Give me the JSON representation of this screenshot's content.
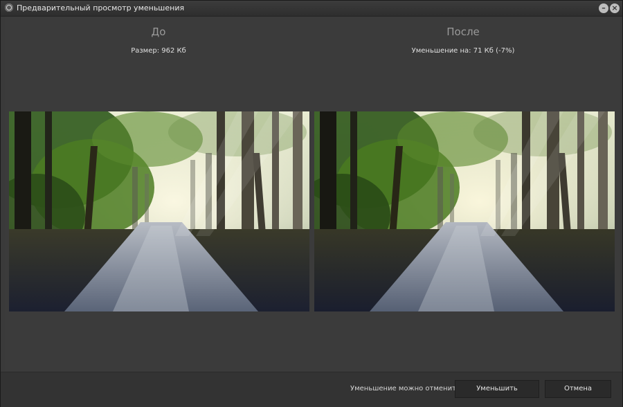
{
  "window": {
    "title": "Предварительный просмотр уменьшения",
    "icons": {
      "app": "app-icon",
      "minimize": "minimize-icon",
      "close": "close-icon"
    }
  },
  "before": {
    "heading": "До",
    "size_text": "Размер: 962 Кб"
  },
  "after": {
    "heading": "После",
    "reduction_text": "Уменьшение на: 71 Кб (-7%)"
  },
  "footer": {
    "undo_note": "Уменьшение можно отменить",
    "reduce_label": "Уменьшить",
    "cancel_label": "Отмена"
  },
  "colors": {
    "window_bg": "#3b3b3b",
    "titlebar": "#2e2e2e",
    "button_bg": "#2a2a2a"
  }
}
